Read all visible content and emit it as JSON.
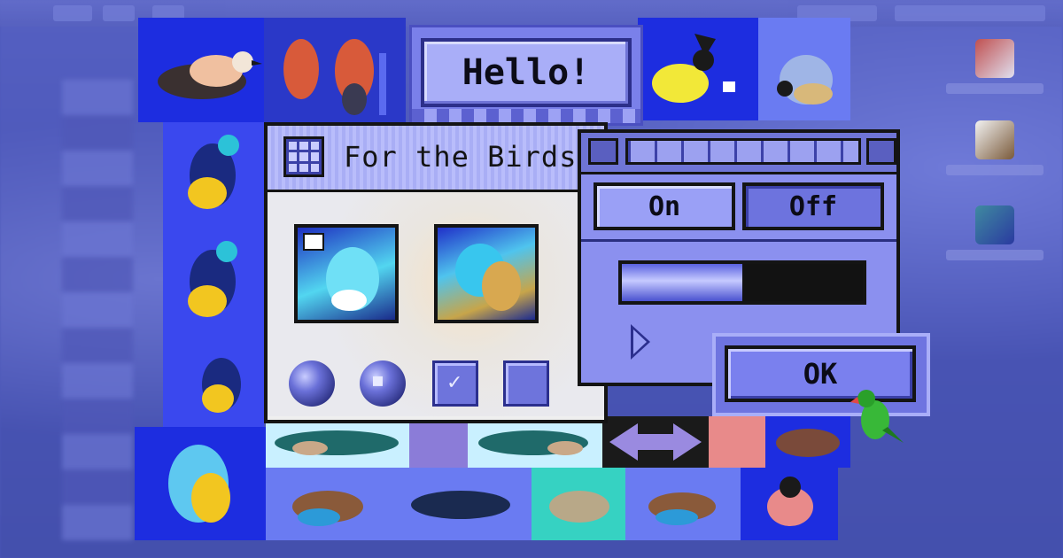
{
  "hello_panel": {
    "label": "Hello!"
  },
  "main_window": {
    "title": "For the Birds"
  },
  "control_panel": {
    "toggle_on_label": "On",
    "toggle_off_label": "Off",
    "toggle_selected": "Off",
    "progress_fraction": 0.5
  },
  "dialog": {
    "ok_label": "OK"
  },
  "colors": {
    "accent": "#6e74e0",
    "collage_blue": "#1d2de0",
    "window_border": "#141414",
    "desktop": "#4d57b8"
  },
  "icons": {
    "main_title_icon": "grid-icon",
    "play": "play-triangle-icon",
    "check": "checkmark-icon",
    "photo_badge": "window-badge-icon",
    "parrot": "parrot-icon"
  }
}
